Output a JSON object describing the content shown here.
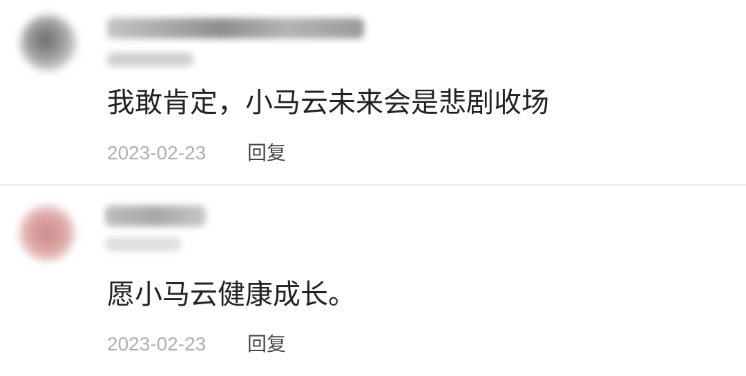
{
  "comments": [
    {
      "text": "我敢肯定，小马云未来会是悲剧收场",
      "date": "2023-02-23",
      "reply_label": "回复"
    },
    {
      "text": "愿小马云健康成长。",
      "date": "2023-02-23",
      "reply_label": "回复"
    }
  ]
}
